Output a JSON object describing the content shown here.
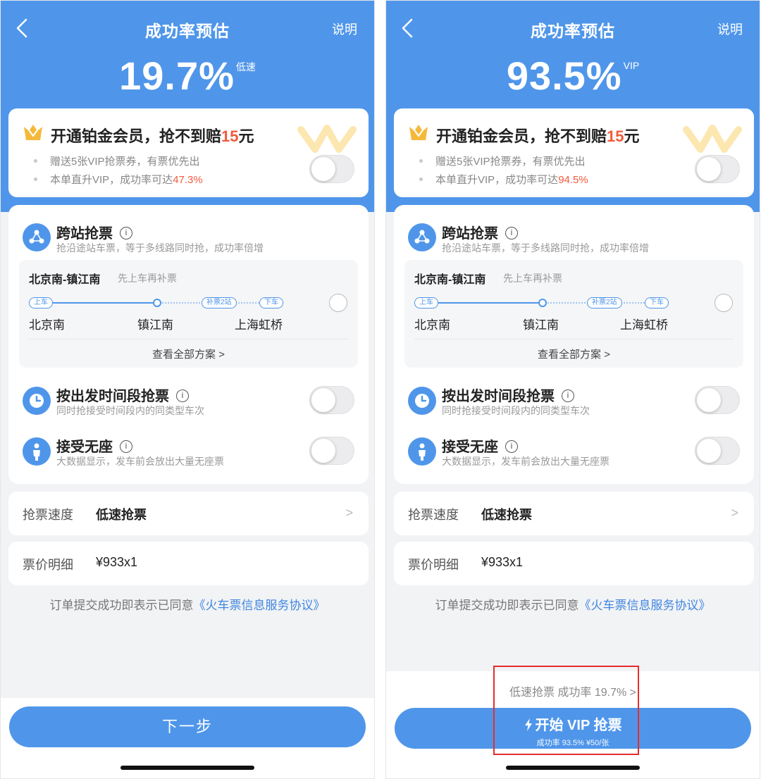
{
  "screens": [
    {
      "nav": {
        "title": "成功率预估",
        "help": "说明"
      },
      "rate": {
        "value": "19.7%",
        "tag": "低速"
      },
      "vip": {
        "title_pre": "开通铂金会员，抢不到赔",
        "amount": "15",
        "title_post": "元",
        "line1": "赠送5张VIP抢票券，有票优先出",
        "line2_pre": "本单直升VIP，成功率可达",
        "line2_value": "47.3%",
        "toggle_on": false
      },
      "cross": {
        "title": "跨站抢票",
        "subtitle": "抢沿途站车票，等于多线路同时抢，成功率倍增",
        "route_name": "北京南-镇江南",
        "route_hint": "先上车再补票",
        "pill_board": "上车",
        "pill_makeup": "补票2站",
        "pill_alight": "下车",
        "station_from": "北京南",
        "station_mid": "镇江南",
        "station_to": "上海虹桥",
        "view_all": "查看全部方案 >"
      },
      "time_slot": {
        "title": "按出发时间段抢票",
        "subtitle": "同时抢接受时间段内的同类型车次",
        "toggle_on": false
      },
      "no_seat": {
        "title": "接受无座",
        "subtitle": "大数据显示，发车前会放出大量无座票",
        "toggle_on": false
      },
      "speed": {
        "label": "抢票速度",
        "value": "低速抢票",
        "chevron": ">"
      },
      "price": {
        "label": "票价明细",
        "value": "¥933x1"
      },
      "agreement": {
        "text": "订单提交成功即表示已同意",
        "link": "《火车票信息服务协议》"
      },
      "cta": {
        "label": "下一步"
      }
    },
    {
      "nav": {
        "title": "成功率预估",
        "help": "说明"
      },
      "rate": {
        "value": "93.5%",
        "tag": "VIP"
      },
      "vip": {
        "title_pre": "开通铂金会员，抢不到赔",
        "amount": "15",
        "title_post": "元",
        "line1": "赠送5张VIP抢票券，有票优先出",
        "line2_pre": "本单直升VIP，成功率可达",
        "line2_value": "94.5%",
        "toggle_on": false
      },
      "cross": {
        "title": "跨站抢票",
        "subtitle": "抢沿途站车票，等于多线路同时抢，成功率倍增",
        "route_name": "北京南-镇江南",
        "route_hint": "先上车再补票",
        "pill_board": "上车",
        "pill_makeup": "补票2站",
        "pill_alight": "下车",
        "station_from": "北京南",
        "station_mid": "镇江南",
        "station_to": "上海虹桥",
        "view_all": "查看全部方案 >"
      },
      "time_slot": {
        "title": "按出发时间段抢票",
        "subtitle": "同时抢接受时间段内的同类型车次",
        "toggle_on": false
      },
      "no_seat": {
        "title": "接受无座",
        "subtitle": "大数据显示，发车前会放出大量无座票",
        "toggle_on": false
      },
      "speed": {
        "label": "抢票速度",
        "value": "低速抢票",
        "chevron": ">"
      },
      "price": {
        "label": "票价明细",
        "value": "¥933x1"
      },
      "agreement": {
        "text": "订单提交成功即表示已同意",
        "link": "《火车票信息服务协议》"
      },
      "slow_option": "低速抢票 成功率 19.7% >",
      "cta": {
        "label": "开始 VIP 抢票",
        "sub": "成功率 93.5% ¥50/张"
      }
    }
  ],
  "colors": {
    "primary": "#4f96ea",
    "accent": "#f25a3c",
    "highlight": "#e52d2d"
  },
  "icons": [
    "back-arrow-icon",
    "crown-icon",
    "info-icon",
    "network-icon",
    "clock-icon",
    "person-icon",
    "bolt-icon"
  ]
}
